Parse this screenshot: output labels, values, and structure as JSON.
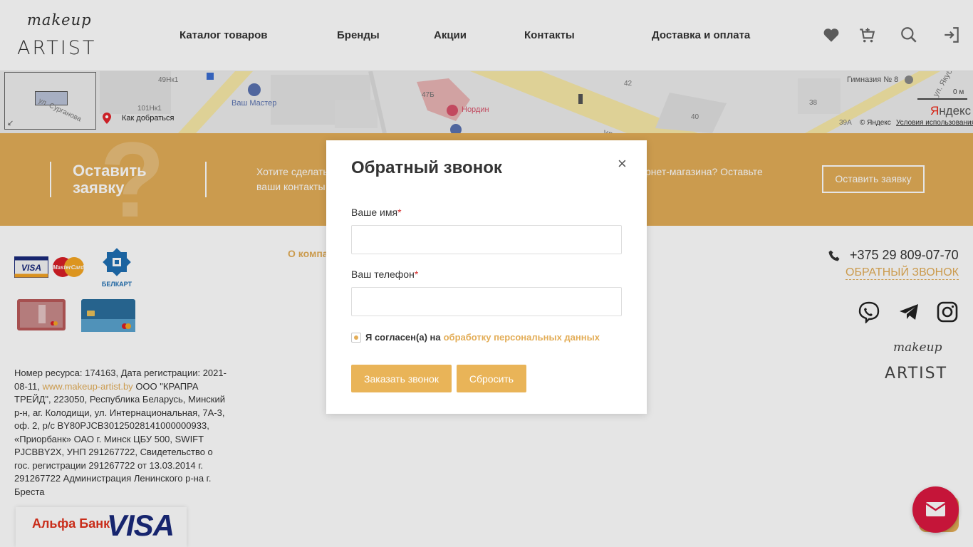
{
  "header": {
    "logo": {
      "script": "makeup",
      "word": "ARTIST"
    },
    "nav": [
      "Каталог товаров",
      "Бренды",
      "Акции",
      "Контакты",
      "Доставка и оплата"
    ],
    "icons": [
      "heart-icon",
      "cart-icon",
      "search-icon",
      "login-icon"
    ]
  },
  "map": {
    "labels": {
      "house_49": "49Нк1",
      "house_101": "101Нк1",
      "street_surganova": "ул. Сурганова",
      "vash_master": "Ваш Мастер",
      "house_47b": "47Б",
      "nordin": "Нордин",
      "house_42": "42",
      "house_40": "40",
      "house_38": "38",
      "house_39a": "39А",
      "gymnasium": "Гимназия № 8",
      "street_yakuba": "ул. Якуба",
      "street_ul": "ул.",
      "scale": "0 м"
    },
    "how_to_get": "Как добраться",
    "copyright": "© Яндекс",
    "terms": "Условия использования",
    "brand": "Яндекс"
  },
  "cta": {
    "title": "Оставить заявку",
    "text_line1_left": "Хотите сделать",
    "text_line1_right": "рнет-магазина? Оставьте",
    "text_line2_left": "ваши контакты",
    "button": "Оставить заявку"
  },
  "footer": {
    "cards": [
      "VISA",
      "MasterCard",
      "БЕЛКАРТ"
    ],
    "about": "О компа",
    "legal_prefix": "Номер ресурса: 174163, Дата регистрации: 2021-08-11,",
    "legal_link": "www.makeup-artist.by",
    "legal_rest": "ООО \"КРАПРА ТРЕЙД\", 223050, Республика Беларусь, Минский р-н, аг. Колодищи, ул. Интернациональная, 7А-3, оф. 2, р/с BY80PJCB30125028141000000933, «Приорбанк» ОАО г. Минск ЦБУ 500, SWIFT PJCBBY2X, УНП 291267722, Свидетельство о гос. регистрации 291267722 от 13.03.2014 г. 291267722 Администрация Ленинского р-на г. Бреста",
    "phone": "+375 29 809-07-70",
    "callback": "ОБРАТНЫЙ ЗВОНОК",
    "social": [
      "viber-icon",
      "telegram-icon",
      "instagram-icon"
    ],
    "logo_script": "makeup",
    "logo_word": "ARTIST",
    "bank": {
      "name": "Альфа Банк",
      "card": "VISA"
    }
  },
  "modal": {
    "title": "Обратный звонок",
    "close": "×",
    "name_label": "Ваше имя",
    "phone_label": "Ваш телефон",
    "required_mark": "*",
    "name_value": "",
    "phone_value": "",
    "agree_text": "Я согласен(а) на",
    "agree_link": "обработку персональных данных",
    "agree_checked": true,
    "submit": "Заказать звонок",
    "reset": "Сбросить"
  },
  "colors": {
    "accent": "#e3ad57",
    "fab": "#dc1840"
  }
}
